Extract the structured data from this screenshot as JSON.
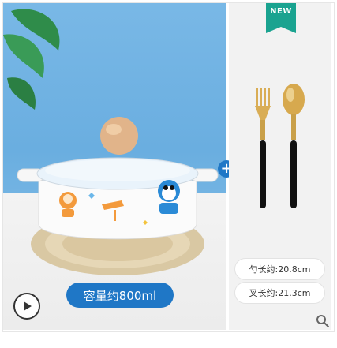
{
  "badge": {
    "label": "NEW",
    "color": "#1aa390"
  },
  "product": {
    "capacity_label": "容量约800ml",
    "specs": [
      {
        "label": "勺长约:20.8cm"
      },
      {
        "label": "叉长约:21.3cm"
      }
    ]
  },
  "controls": {
    "play_icon": "play-icon",
    "plus_icon": "plus-icon",
    "zoom_icon": "search-icon",
    "plus_label": "+"
  },
  "colors": {
    "accent": "#1f77c6",
    "background": "#f2f2f2"
  }
}
